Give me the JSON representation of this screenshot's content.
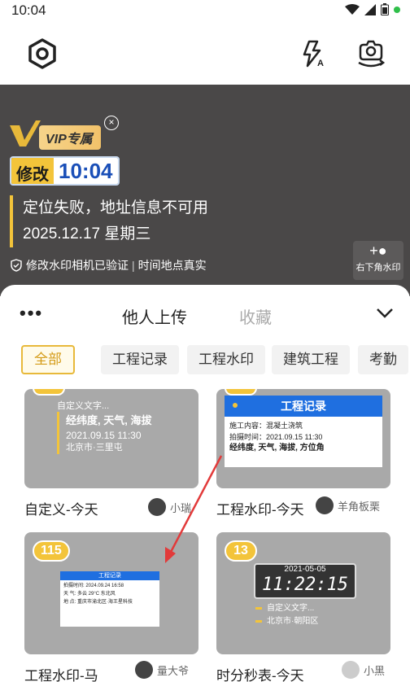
{
  "status_bar": {
    "time": "10:04"
  },
  "toolbar": {
    "settings_icon": "hexagon-settings-icon",
    "flash_icon": "flash-auto-icon",
    "switch_camera_icon": "switch-camera-icon"
  },
  "preview": {
    "vip_label": "VIP专属",
    "time_badge_label": "修改",
    "time_badge_clock": "10:04",
    "location_line": "定位失败，地址信息不可用",
    "date_line": "2025.12.17 星期三",
    "verify_text": "修改水印相机已验证",
    "verify_text2": "时间地点真实",
    "corner_button_label": "右下角水印"
  },
  "sheet": {
    "more": "•••",
    "tab_active": "他人上传",
    "tab_inactive": "收藏",
    "chips": [
      "全部",
      "工程记录",
      "工程水印",
      "建筑工程",
      "考勤"
    ]
  },
  "cards": [
    {
      "caption": "自定义-今天",
      "author": "小瑞",
      "thumb": {
        "line1": "自定义文字...",
        "line2": "经纬度, 天气, 海拔",
        "line3": "2021.09.15 11:30",
        "line4": "北京市·三里屯"
      }
    },
    {
      "caption": "工程水印-今天",
      "author": "羊角板栗",
      "thumb": {
        "title": "工程记录",
        "row1": "施工内容：混凝土浇筑",
        "row2": "拍摄时间：2021.09.15 11:30",
        "row3": "经纬度, 天气, 海拔, 方位角"
      }
    },
    {
      "caption": "工程水印-马",
      "author": "量大爷",
      "badge": "115",
      "thumb": {
        "title": "工程记录",
        "r1k": "拍摄时间:",
        "r1v": "2024.09.24 16:58",
        "r2k": "天    气:",
        "r2v": "多云 29°C 东北风",
        "r3k": "地    点:",
        "r3v": "重庆市渝北区·海王星科技"
      }
    },
    {
      "caption": "时分秒表-今天",
      "author": "小黑",
      "badge": "13",
      "thumb": {
        "date": "2021-05-05",
        "clock": "11:22:15",
        "line1": "自定义文字...",
        "line2": "北京市·朝阳区"
      }
    }
  ]
}
